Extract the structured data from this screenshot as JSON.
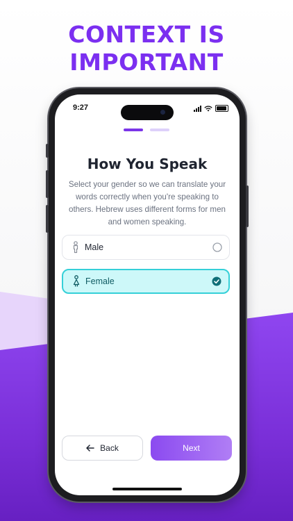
{
  "headline": [
    "CONTEXT IS",
    "IMPORTANT"
  ],
  "status_bar": {
    "time": "9:27"
  },
  "screen": {
    "progress": {
      "step": 1,
      "total": 2
    },
    "title": "How You Speak",
    "subtitle": "Select your gender so we can translate your words correctly when you're speaking to others. Hebrew uses different forms for men and women speaking.",
    "options": [
      {
        "label": "Male",
        "icon": "male-person-icon",
        "selected": false
      },
      {
        "label": "Female",
        "icon": "female-person-icon",
        "selected": true
      }
    ],
    "back_label": "Back",
    "next_label": "Next"
  },
  "colors": {
    "accent": "#7b2ff0",
    "selected_border": "#35d0d8",
    "selected_bg": "#cdf8f9",
    "check": "#0f6f78"
  }
}
